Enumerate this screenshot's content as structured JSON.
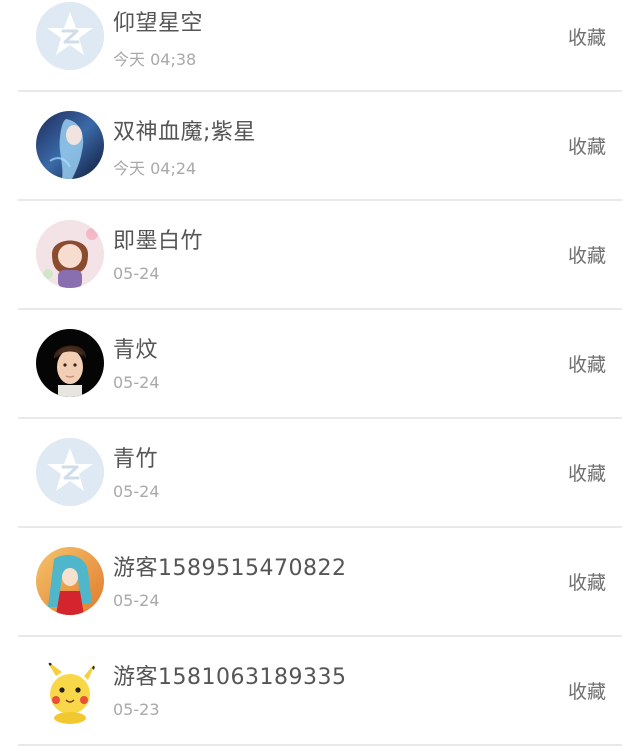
{
  "contacts": [
    {
      "name": "仰望星空",
      "time": "今天 04;38",
      "action": "收藏",
      "avatar": "qq-default-avatar"
    },
    {
      "name": "双神血魔;紫星",
      "time": "今天 04;24",
      "action": "收藏",
      "avatar": "anime-girl-blue-avatar"
    },
    {
      "name": "即墨白竹",
      "time": "05-24",
      "action": "收藏",
      "avatar": "anime-girl-brown-hair-avatar"
    },
    {
      "name": "青炆",
      "time": "05-24",
      "action": "收藏",
      "avatar": "anime-boy-avatar"
    },
    {
      "name": "青竹",
      "time": "05-24",
      "action": "收藏",
      "avatar": "qq-default-avatar"
    },
    {
      "name": "游客1589515470822",
      "time": "05-24",
      "action": "收藏",
      "avatar": "anime-girl-red-dress-avatar"
    },
    {
      "name": "游客1581063189335",
      "time": "05-23",
      "action": "收藏",
      "avatar": "pikachu-avatar"
    }
  ],
  "colors": {
    "divider": "#e9e9e9",
    "name_text": "#555555",
    "time_text": "#a9a9a9",
    "action_text": "#707070",
    "qq_avatar_bg": "#dfe9f3"
  }
}
